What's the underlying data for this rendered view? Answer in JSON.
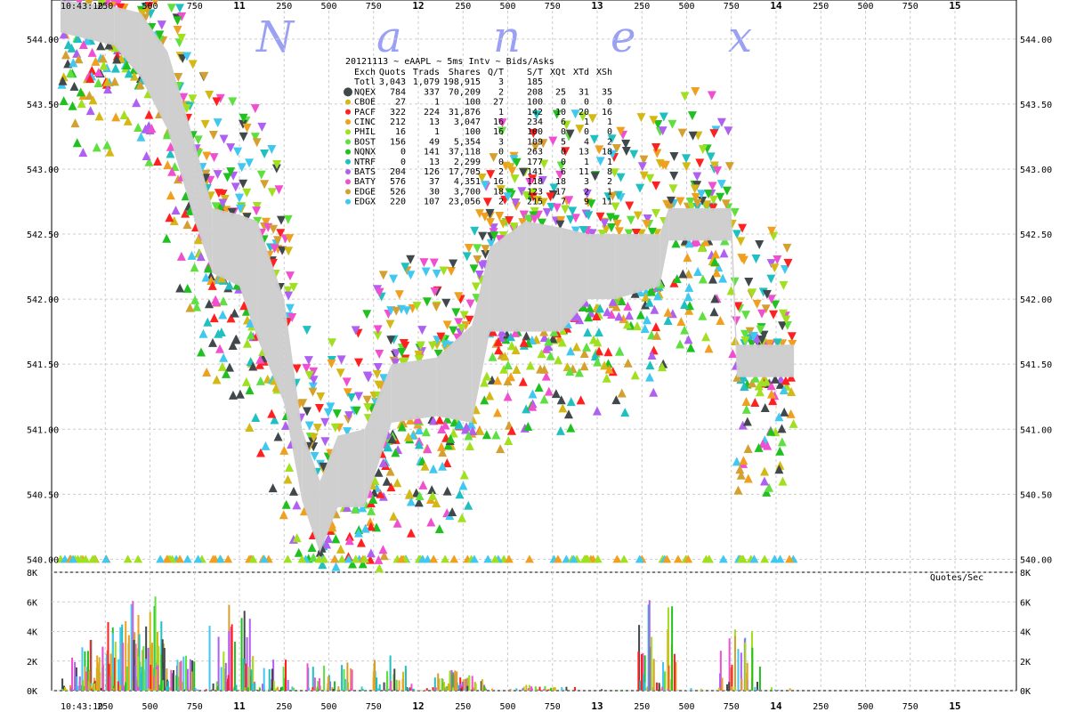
{
  "watermark": [
    "N",
    "a",
    "n",
    "e",
    "x"
  ],
  "colors": {
    "spread": "#cccccc",
    "grid": "#cccccc",
    "watermark": "#9aa0f4"
  },
  "chart_data": {
    "type": "scatter",
    "title": "20121113 ~ eAAPL ~ 5ms Intv ~ Bids/Asks",
    "y_ticks": [
      "544.00",
      "543.50",
      "543.00",
      "542.50",
      "542.00",
      "541.50",
      "541.00",
      "540.50",
      "540.00"
    ],
    "ylim": [
      539.9,
      544.3
    ],
    "x_start_label": "10:43:10",
    "x_ticks": [
      "250",
      "500",
      "750",
      "11",
      "250",
      "500",
      "750",
      "12",
      "250",
      "500",
      "750",
      "13",
      "250",
      "500",
      "750",
      "14",
      "250",
      "500",
      "750",
      "15"
    ],
    "volume_panel": {
      "label": "Quotes/Sec",
      "y_ticks": [
        "8K",
        "6K",
        "4K",
        "2K",
        "0K"
      ],
      "ylim": [
        0,
        8000
      ],
      "bursts": [
        {
          "t": 0.1,
          "level": 2500
        },
        {
          "t": 0.2,
          "level": 3500
        },
        {
          "t": 0.35,
          "level": 5500
        },
        {
          "t": 0.45,
          "level": 6500
        },
        {
          "t": 0.55,
          "level": 4800
        },
        {
          "t": 0.65,
          "level": 3200
        },
        {
          "t": 0.95,
          "level": 6000
        },
        {
          "t": 1.15,
          "level": 2200
        },
        {
          "t": 1.5,
          "level": 2000
        },
        {
          "t": 1.85,
          "level": 2500
        },
        {
          "t": 2.2,
          "level": 1200
        },
        {
          "t": 2.25,
          "level": 1500
        },
        {
          "t": 2.7,
          "level": 400
        },
        {
          "t": 3.35,
          "level": 6200
        },
        {
          "t": 3.8,
          "level": 4500
        }
      ]
    },
    "table": {
      "headers": [
        "Exch",
        "Quots",
        "Trads",
        "Shares",
        "Q/T",
        "S/T",
        "XQt",
        "XTd",
        "XSh"
      ],
      "total": [
        "Totl",
        "3,043",
        "1,079",
        "198,915",
        "3",
        "185",
        "",
        "",
        ""
      ],
      "rows": [
        {
          "exch": "NQEX",
          "color": "#40484c",
          "cells": [
            "784",
            "337",
            "70,209",
            "2",
            "208",
            "25",
            "31",
            "35"
          ]
        },
        {
          "exch": "CBOE",
          "color": "#d4b816",
          "cells": [
            "27",
            "1",
            "100",
            "27",
            "100",
            "0",
            "0",
            "0"
          ]
        },
        {
          "exch": "PACF",
          "color": "#ff2020",
          "cells": [
            "322",
            "224",
            "31,876",
            "1",
            "142",
            "10",
            "20",
            "16"
          ]
        },
        {
          "exch": "CINC",
          "color": "#f0a020",
          "cells": [
            "212",
            "13",
            "3,047",
            "16",
            "234",
            "6",
            "1",
            "1"
          ]
        },
        {
          "exch": "PHIL",
          "color": "#a0e020",
          "cells": [
            "16",
            "1",
            "100",
            "16",
            "100",
            "0",
            "0",
            "0"
          ]
        },
        {
          "exch": "BOST",
          "color": "#60e040",
          "cells": [
            "156",
            "49",
            "5,354",
            "3",
            "109",
            "5",
            "4",
            "2"
          ]
        },
        {
          "exch": "NQNX",
          "color": "#20c020",
          "cells": [
            "0",
            "141",
            "37,118",
            "0",
            "263",
            "0",
            "13",
            "18"
          ]
        },
        {
          "exch": "NTRF",
          "color": "#20c0c0",
          "cells": [
            "0",
            "13",
            "2,299",
            "0",
            "177",
            "0",
            "1",
            "1"
          ]
        },
        {
          "exch": "BATS",
          "color": "#b060f0",
          "cells": [
            "204",
            "126",
            "17,705",
            "2",
            "141",
            "6",
            "11",
            "8"
          ]
        },
        {
          "exch": "BATY",
          "color": "#f050d0",
          "cells": [
            "576",
            "37",
            "4,351",
            "16",
            "118",
            "18",
            "3",
            "2"
          ]
        },
        {
          "exch": "EDGE",
          "color": "#d4a030",
          "cells": [
            "526",
            "30",
            "3,700",
            "18",
            "123",
            "17",
            "2",
            "1"
          ]
        },
        {
          "exch": "EDGX",
          "color": "#40c8f0",
          "cells": [
            "220",
            "107",
            "23,056",
            "2",
            "215",
            "7",
            "9",
            "11"
          ]
        }
      ]
    },
    "nbbo_path": [
      {
        "t": 0.0,
        "bid": 544.05,
        "ask": 544.3
      },
      {
        "t": 0.3,
        "bid": 543.95,
        "ask": 544.25
      },
      {
        "t": 0.45,
        "bid": 543.7,
        "ask": 544.2
      },
      {
        "t": 0.6,
        "bid": 543.3,
        "ask": 543.9
      },
      {
        "t": 0.75,
        "bid": 542.6,
        "ask": 543.2
      },
      {
        "t": 0.85,
        "bid": 542.2,
        "ask": 542.7
      },
      {
        "t": 1.0,
        "bid": 542.1,
        "ask": 542.65
      },
      {
        "t": 1.1,
        "bid": 541.7,
        "ask": 542.6
      },
      {
        "t": 1.25,
        "bid": 541.2,
        "ask": 542.0
      },
      {
        "t": 1.35,
        "bid": 540.45,
        "ask": 541.0
      },
      {
        "t": 1.45,
        "bid": 540.05,
        "ask": 540.6
      },
      {
        "t": 1.55,
        "bid": 540.4,
        "ask": 540.95
      },
      {
        "t": 1.7,
        "bid": 540.4,
        "ask": 541.0
      },
      {
        "t": 1.85,
        "bid": 541.05,
        "ask": 541.5
      },
      {
        "t": 2.1,
        "bid": 541.1,
        "ask": 541.55
      },
      {
        "t": 2.3,
        "bid": 541.05,
        "ask": 541.8
      },
      {
        "t": 2.4,
        "bid": 541.75,
        "ask": 542.4
      },
      {
        "t": 2.6,
        "bid": 541.75,
        "ask": 542.6
      },
      {
        "t": 2.8,
        "bid": 541.75,
        "ask": 542.55
      },
      {
        "t": 2.95,
        "bid": 542.0,
        "ask": 542.5
      },
      {
        "t": 3.1,
        "bid": 542.0,
        "ask": 542.5
      },
      {
        "t": 3.35,
        "bid": 542.1,
        "ask": 542.5
      },
      {
        "t": 3.4,
        "bid": 542.45,
        "ask": 542.7
      },
      {
        "t": 3.75,
        "bid": 542.45,
        "ask": 542.7
      },
      {
        "t": 3.78,
        "bid": 541.4,
        "ask": 541.65
      },
      {
        "t": 4.1,
        "bid": 541.4,
        "ask": 541.65
      }
    ]
  }
}
